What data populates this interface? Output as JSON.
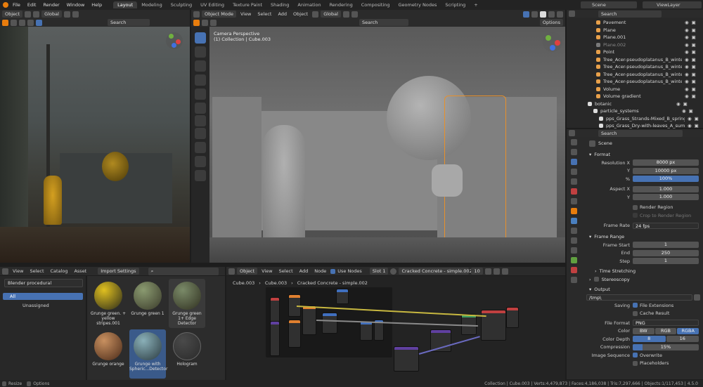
{
  "topbar": {
    "menu": [
      "File",
      "Edit",
      "Render",
      "Window",
      "Help"
    ],
    "workspaces": [
      "Layout",
      "Modeling",
      "Sculpting",
      "UV Editing",
      "Texture Paint",
      "Shading",
      "Animation",
      "Rendering",
      "Compositing",
      "Geometry Nodes",
      "Scripting"
    ],
    "active_workspace": "Layout",
    "scene": "Scene",
    "view_layer": "ViewLayer"
  },
  "left_viewport": {
    "mode": "Object",
    "orientation": "Global",
    "search_placeholder": "Search"
  },
  "main_viewport": {
    "mode": "Object Mode",
    "menu": [
      "View",
      "Select",
      "Add",
      "Object"
    ],
    "orientation": "Global",
    "options_label": "Options",
    "camera_label": "Camera Perspective",
    "collection_label": "(1) Collection | Cube.003"
  },
  "outliner": {
    "search_placeholder": "Search",
    "items": [
      {
        "label": "Pavement",
        "color": "#e8a04a"
      },
      {
        "label": "Plane",
        "color": "#e8a04a"
      },
      {
        "label": "Plane.001",
        "color": "#e8a04a"
      },
      {
        "label": "Plane.002",
        "color": "#7a7a7a"
      },
      {
        "label": "Point",
        "color": "#e8a04a"
      },
      {
        "label": "Tree_Acer-pseudoplatanus_B_winter.0",
        "color": "#e8a04a"
      },
      {
        "label": "Tree_Acer-pseudoplatanus_B_winter.0",
        "color": "#e8a04a"
      },
      {
        "label": "Tree_Acer-pseudoplatanus_B_winter.0",
        "color": "#e8a04a"
      },
      {
        "label": "Tree_Acer-pseudoplatanus_B_winter.0",
        "color": "#e8a04a"
      },
      {
        "label": "Volume",
        "color": "#e8a04a"
      },
      {
        "label": "Volume gradient",
        "color": "#e8a04a"
      },
      {
        "label": "botanic",
        "color": "#ddd"
      },
      {
        "label": "particle_systems",
        "color": "#ddd"
      },
      {
        "label": "pps_Grass_Strands-Mixed_B_spring",
        "color": "#ddd"
      },
      {
        "label": "pps_Grass_Dry-with-leaves_A_sum",
        "color": "#ddd"
      }
    ]
  },
  "properties": {
    "search_placeholder": "Search",
    "scene_name": "Scene",
    "sections": {
      "format": "Format",
      "frame_range": "Frame Range",
      "time_stretching": "Time Stretching",
      "stereoscopy": "Stereoscopy",
      "output": "Output"
    },
    "resolution_x_label": "Resolution X",
    "resolution_x": "8000 px",
    "y_label": "Y",
    "resolution_y": "10000 px",
    "percent_label": "%",
    "percent": "100%",
    "aspect_x_label": "Aspect X",
    "aspect_x": "1.000",
    "aspect_y": "1.000",
    "render_region": "Render Region",
    "crop_region": "Crop to Render Region",
    "frame_rate_label": "Frame Rate",
    "frame_rate": "24 fps",
    "frame_start_label": "Frame Start",
    "frame_start": "1",
    "end_label": "End",
    "frame_end": "250",
    "step_label": "Step",
    "frame_step": "1",
    "output_path": "/tmp\\",
    "saving_label": "Saving",
    "file_extensions": "File Extensions",
    "cache_result": "Cache Result",
    "file_format_label": "File Format",
    "file_format": "PNG",
    "color_label": "Color",
    "color_modes": [
      "BW",
      "RGB",
      "RGBA"
    ],
    "color_depth_label": "Color Depth",
    "color_depths": [
      "8",
      "16"
    ],
    "compression_label": "Compression",
    "compression": "15%",
    "compression_fraction": 0.15,
    "image_sequence_label": "Image Sequence",
    "overwrite": "Overwrite",
    "placeholders": "Placeholders"
  },
  "asset_browser": {
    "menu": [
      "View",
      "Select",
      "Catalog",
      "Asset"
    ],
    "import_settings": "Import Settings",
    "library": "Blender procedural",
    "catalogs": [
      "All",
      "Unassigned"
    ],
    "assets": [
      {
        "label": "Grunge green. + yellow stripes.001",
        "colors": [
          "#e0c020",
          "#2a2a1a"
        ]
      },
      {
        "label": "Grunge green 1",
        "colors": [
          "#8a9a70",
          "#3a3a2a"
        ]
      },
      {
        "label": "Grunge green 1+ Edge Detector",
        "colors": [
          "#7a8a68",
          "#303020"
        ]
      },
      {
        "label": "Grunge orange",
        "colors": [
          "#c89060",
          "#4a2a18"
        ]
      },
      {
        "label": "Grunge with Spheric...Detector",
        "colors": [
          "#8ab0b8",
          "#2a3a40"
        ]
      },
      {
        "label": "Hologram",
        "colors": [
          "#4a4a4a",
          "#2a2a2a"
        ]
      }
    ]
  },
  "node_editor": {
    "mode": "Object",
    "menu": [
      "View",
      "Select",
      "Add",
      "Node"
    ],
    "use_nodes": "Use Nodes",
    "slot": "Slot 1",
    "material": "Cracked Concrete - simple.002",
    "users": "10",
    "breadcrumb": [
      "Cube.003",
      "Cube.003",
      "Cracked Concrete - simple.002"
    ]
  },
  "status_bar": {
    "left": [
      "Resize",
      "Options"
    ],
    "right": "Collection | Cube.003 | Verts:4,479,873 | Faces:4,186,038 | Tris:7,297,666 | Objects:1/117,453 | 4.5.0"
  }
}
